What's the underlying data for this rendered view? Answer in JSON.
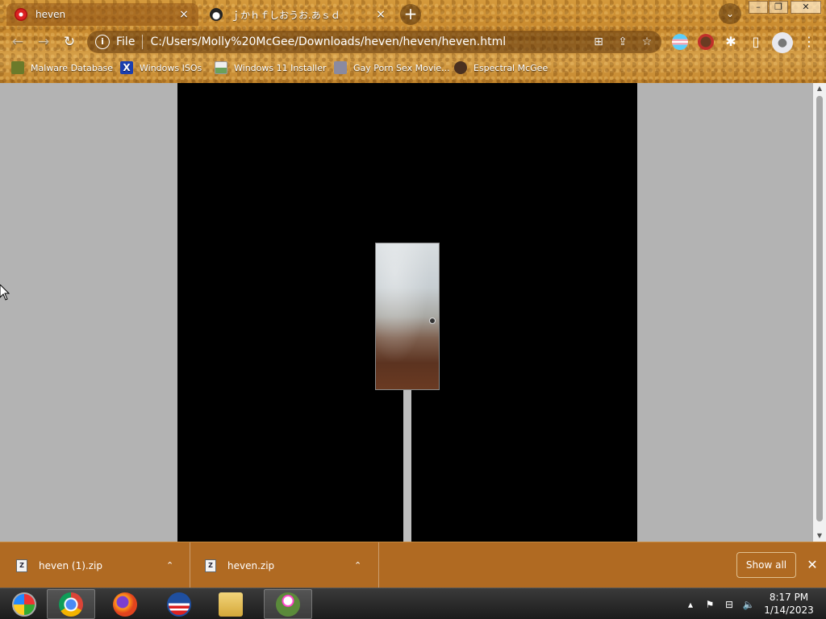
{
  "tabs": [
    {
      "title": "heven",
      "favicon": "lips-favicon",
      "active": true,
      "close": "×"
    },
    {
      "title": "ｊかｈｆしおうお.あｓｄ",
      "favicon": "anime-avatar-favicon",
      "active": false,
      "close": "×"
    }
  ],
  "new_tab_label": "+",
  "tab_search_icon": "⌄",
  "window_controls": {
    "minimize": "–",
    "maximize": "❐",
    "close": "✕"
  },
  "nav": {
    "back": "←",
    "forward": "→",
    "reload": "↻"
  },
  "omnibox": {
    "info_icon": "i",
    "scheme": "File",
    "url": "C:/Users/Molly%20McGee/Downloads/heven/heven/heven.html",
    "translate_icon": "⊞",
    "share_icon": "⇪",
    "star_icon": "☆"
  },
  "toolbar_icons": {
    "puzzle": "✱",
    "sidepanel": "▯",
    "profile": "●",
    "menu": "⋮"
  },
  "bookmarks": [
    {
      "label": "Malware Database",
      "icon": "bug-icon",
      "color": "#6b7a2a"
    },
    {
      "label": "Windows ISOs",
      "icon": "x-icon",
      "color": "#1a3fb0"
    },
    {
      "label": "Windows 11 Installer",
      "icon": "image-icon",
      "color": "#e8e8e8"
    },
    {
      "label": "Gay Porn Sex Movie...",
      "icon": "figure-icon",
      "color": "#8a8aa0"
    },
    {
      "label": "Espectral McGee",
      "icon": "character-icon",
      "color": "#4a3020"
    }
  ],
  "downloads": [
    {
      "filename": "heven (1).zip",
      "caret": "⌃"
    },
    {
      "filename": "heven.zip",
      "caret": "⌃"
    }
  ],
  "download_bar": {
    "show_all": "Show all",
    "close": "✕"
  },
  "taskbar": {
    "apps": [
      {
        "name": "start-orb",
        "color": "#2aa34a"
      },
      {
        "name": "chrome",
        "color": "#db4437"
      },
      {
        "name": "firefox",
        "color": "#ff7a1a"
      },
      {
        "name": "obama-logo",
        "color": "#1f4fa0"
      },
      {
        "name": "file-explorer",
        "color": "#e8c45a"
      },
      {
        "name": "flower-app",
        "color": "#5a8a3a"
      }
    ],
    "tray": {
      "chevron": "▴",
      "flag": "⚑",
      "network": "⊟",
      "volume": "🔈"
    },
    "time": "8:17 PM",
    "date": "1/14/2023"
  },
  "colors": {
    "chrome_brown": "#c98a2e",
    "download_bar": "#b06a22",
    "game_bg": "#000000",
    "page_bg": "#b3b3b3"
  }
}
